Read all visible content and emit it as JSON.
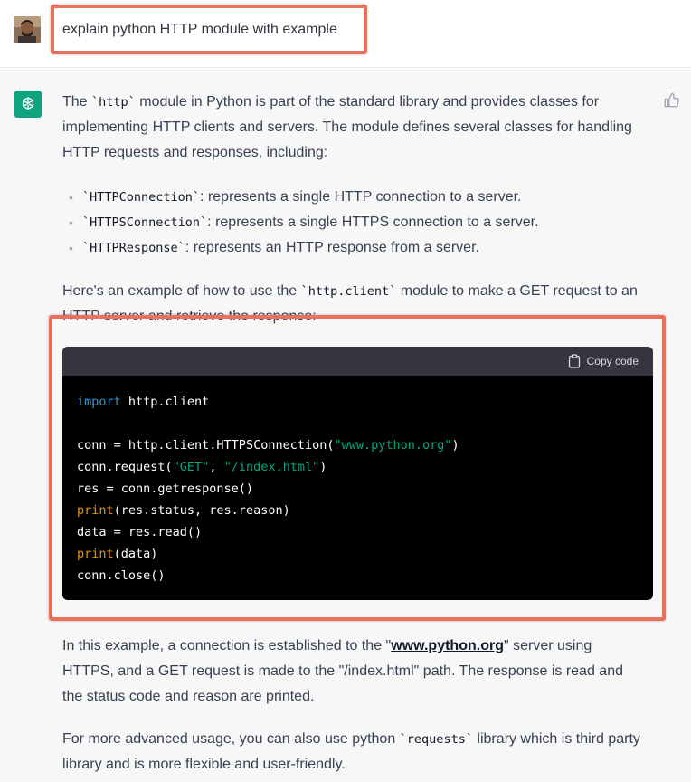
{
  "user": {
    "message": "explain python HTTP module with example"
  },
  "assistant": {
    "intro": {
      "t1": "The ",
      "code": "`http`",
      "t2": " module in Python is part of the standard library and provides classes for",
      "line2": "implementing HTTP clients and servers. The module defines several classes for handling",
      "line3": "HTTP requests and responses, including:"
    },
    "bullets": [
      {
        "code": "`HTTPConnection`",
        "text": ": represents a single HTTP connection to a server."
      },
      {
        "code": "`HTTPSConnection`",
        "text": ": represents a single HTTPS connection to a server."
      },
      {
        "code": "`HTTPResponse`",
        "text": ": represents an HTTP response from a server."
      }
    ],
    "example_intro": {
      "t1": "Here's an example of how to use the ",
      "code": "`http.client`",
      "t2": " module to make a GET request to an",
      "line2": "HTTP server and retrieve the response:"
    },
    "code_block": {
      "copy_label": "Copy code",
      "lines": {
        "l1_kw": "import",
        "l1_rest": " http.client",
        "l3_a": "conn = http.client.HTTPSConnection(",
        "l3_str": "\"www.python.org\"",
        "l3_b": ")",
        "l4_a": "conn.request(",
        "l4_str1": "\"GET\"",
        "l4_sep": ", ",
        "l4_str2": "\"/index.html\"",
        "l4_b": ")",
        "l5": "res = conn.getresponse()",
        "l6_fn": "print",
        "l6_rest": "(res.status, res.reason)",
        "l7": "data = res.read()",
        "l8_fn": "print",
        "l8_rest": "(data)",
        "l9": "conn.close()"
      }
    },
    "explanation": {
      "t1": "In this example, a connection is established to the \"",
      "link": "www.python.org",
      "t2": "\" server using",
      "line2": "HTTPS, and a GET request is made to the \"/index.html\" path. The response is read and",
      "line3": "the status code and reason are printed."
    },
    "advanced": {
      "t1": "For more advanced usage, you can also use python ",
      "code": "`requests`",
      "t2": " library which is third party",
      "line2": "library and is more flexible and user-friendly."
    }
  },
  "colors": {
    "highlight": "#e8705d",
    "gpt_green": "#10a37f",
    "code_bg": "#000000",
    "code_header": "#343541"
  }
}
